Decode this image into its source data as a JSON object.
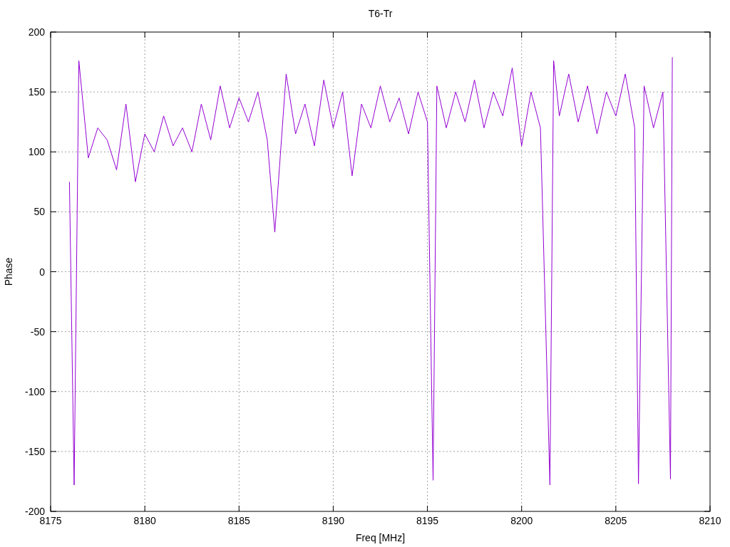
{
  "chart": {
    "chart_data": {
      "type": "line",
      "title": "T6-Tr",
      "xlabel": "Freq [MHz]",
      "ylabel": "Phase",
      "x": [
        8176,
        8176.25,
        8176.5,
        8177,
        8177.5,
        8178,
        8178.5,
        8179,
        8179.5,
        8180,
        8180.5,
        8181,
        8181.5,
        8182,
        8182.5,
        8183,
        8183.5,
        8184,
        8184.5,
        8185,
        8185.5,
        8186,
        8186.5,
        8186.9,
        8187.5,
        8188,
        8188.5,
        8189,
        8189.5,
        8190,
        8190.5,
        8191,
        8191.5,
        8192,
        8192.5,
        8193,
        8193.5,
        8194,
        8194.5,
        8195,
        8195.3,
        8195.5,
        8196,
        8196.5,
        8197,
        8197.5,
        8198,
        8198.5,
        8199,
        8199.5,
        8200,
        8200.5,
        8201,
        8201.5,
        8201.7,
        8202,
        8202.5,
        8203,
        8203.5,
        8204,
        8204.5,
        8205,
        8205.5,
        8206,
        8206.2,
        8206.5,
        8207,
        8207.5,
        8207.9,
        8208
      ],
      "grid": true,
      "series": [
        {
          "color": "#9400d3",
          "values": [
            75,
            -178,
            176,
            95,
            120,
            110,
            85,
            140,
            75,
            115,
            100,
            130,
            105,
            120,
            100,
            140,
            110,
            155,
            120,
            145,
            125,
            150,
            110,
            33,
            165,
            115,
            140,
            105,
            160,
            120,
            150,
            80,
            140,
            120,
            155,
            125,
            145,
            115,
            150,
            125,
            -174,
            155,
            120,
            150,
            125,
            160,
            120,
            150,
            130,
            170,
            105,
            150,
            120,
            -178,
            176,
            130,
            165,
            125,
            155,
            115,
            150,
            130,
            165,
            120,
            -177,
            155,
            120,
            150,
            -173,
            179
          ]
        }
      ],
      "xlim": [
        8175,
        8210
      ],
      "ylim": [
        -200,
        200
      ],
      "xticks": [
        8175,
        8180,
        8185,
        8190,
        8195,
        8200,
        8205,
        8210
      ],
      "yticks": [
        -200,
        -150,
        -100,
        -50,
        0,
        50,
        100,
        150,
        200
      ]
    }
  }
}
